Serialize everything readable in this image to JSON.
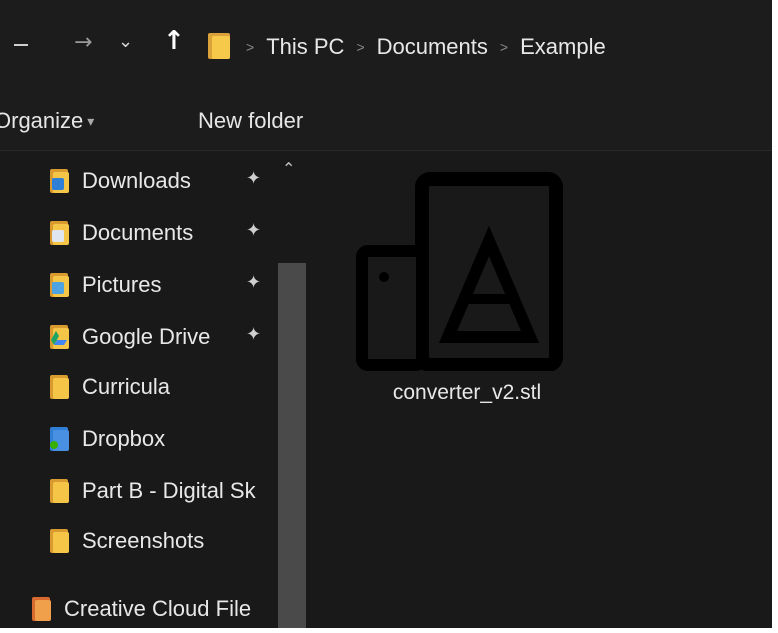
{
  "nav": {
    "back_icon": "back-arrow-icon",
    "forward_icon": "forward-arrow-icon",
    "forward_glyph": "→",
    "recent_icon": "chevron-down-icon",
    "recent_glyph": "⌄",
    "up_icon": "up-arrow-icon",
    "up_glyph": "↑"
  },
  "breadcrumb": {
    "separator": ">",
    "items": [
      "This PC",
      "Documents",
      "Example"
    ]
  },
  "commandbar": {
    "organize_label": "Organize",
    "organize_caret": "▾",
    "new_folder_label": "New folder"
  },
  "sidebar": {
    "pin_glyph": "✦",
    "scroll_up_glyph": "⌃",
    "items": [
      {
        "label": "Downloads",
        "icon": "downloads-folder-icon",
        "pinned": true
      },
      {
        "label": "Documents",
        "icon": "documents-folder-icon",
        "pinned": true
      },
      {
        "label": "Pictures",
        "icon": "pictures-folder-icon",
        "pinned": true
      },
      {
        "label": "Google Drive",
        "icon": "google-drive-icon",
        "pinned": true
      },
      {
        "label": "Curricula",
        "icon": "folder-icon",
        "pinned": false
      },
      {
        "label": "Dropbox",
        "icon": "dropbox-icon",
        "pinned": false
      },
      {
        "label": "Part B - Digital Sk",
        "icon": "folder-icon",
        "pinned": false
      },
      {
        "label": "Screenshots",
        "icon": "folder-icon",
        "pinned": false
      },
      {
        "label": "Creative Cloud File",
        "icon": "creative-cloud-folder-icon",
        "pinned": false
      }
    ]
  },
  "content": {
    "files": [
      {
        "name": "converter_v2.stl",
        "icon": "stl-file-icon"
      }
    ]
  },
  "colors": {
    "background": "#191919",
    "folder": "#f4c547",
    "text": "#e8e8e8"
  }
}
